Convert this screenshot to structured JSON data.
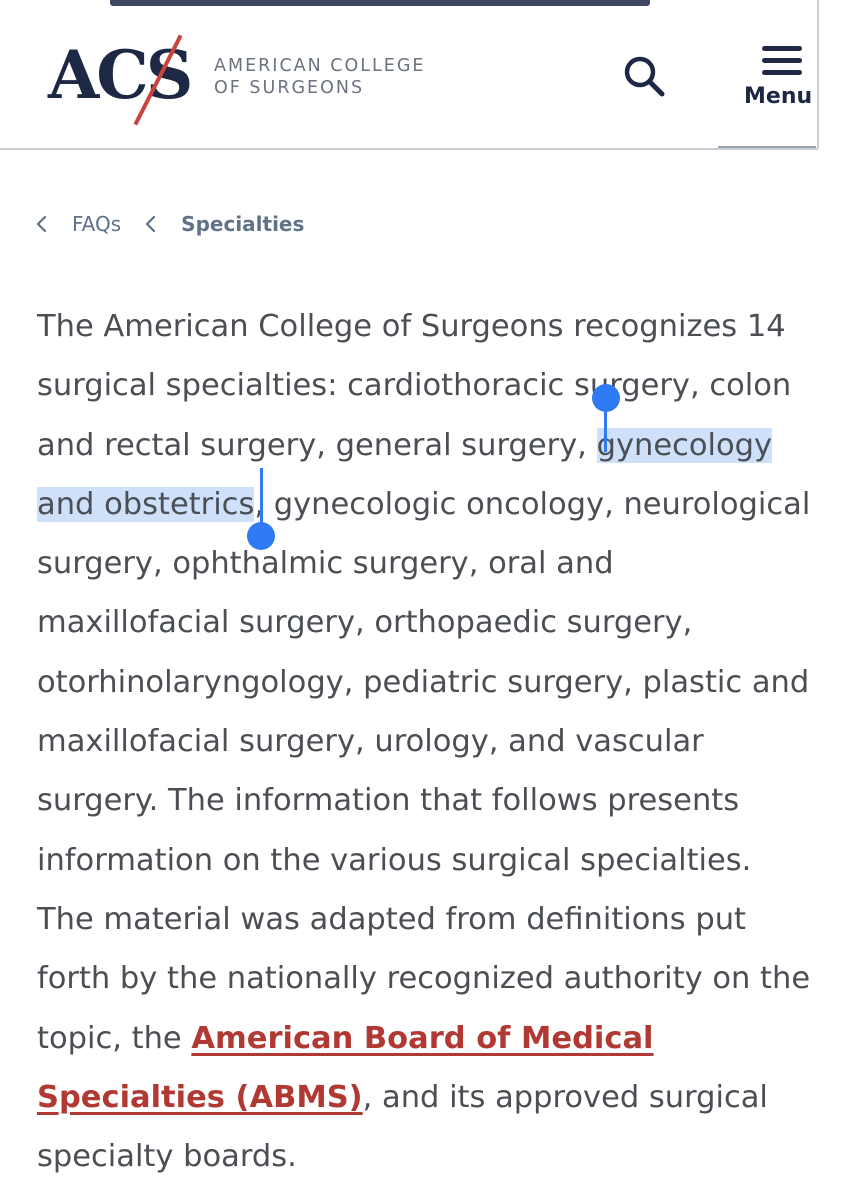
{
  "header": {
    "logo_mark": "ACS",
    "logo_line1": "AMERICAN COLLEGE",
    "logo_line2": "OF SURGEONS",
    "search_icon": "search-icon",
    "menu_icon": "hamburger-icon",
    "menu_label": "Menu"
  },
  "breadcrumb": {
    "items": [
      {
        "label": "FAQs",
        "icon": "chevron-left-icon"
      },
      {
        "label": "Specialties",
        "icon": "chevron-left-icon"
      }
    ]
  },
  "article": {
    "text_before_selection": "The American College of Surgeons recognizes 14 surgical specialties: cardiothoracic surgery, colon and rectal surgery, general surgery, ",
    "selected_text": "gynecology and obstetrics",
    "text_after_selection": ", gynecologic oncology, neurological surgery, ophthalmic surgery, oral and maxillofacial surgery, orthopaedic surgery, otorhinolaryngology, pediatric surgery, plastic and maxillofacial surgery, urology, and vascular surgery. The information that follows presents information on the various surgical specialties. The material was adapted from definitions put forth by the nationally recognized authority on the topic, the ",
    "link_text": "American Board of Medical Specialties (ABMS)",
    "text_after_link": ", and its approved surgical specialty boards."
  },
  "colors": {
    "brand_navy": "#1d2845",
    "brand_red": "#c9443d",
    "link_red": "#b03a33",
    "selection_blue": "#cfe0fb",
    "handle_blue": "#2f7bf4",
    "body_text": "#4b4f55",
    "breadcrumb_text": "#5f7288"
  }
}
